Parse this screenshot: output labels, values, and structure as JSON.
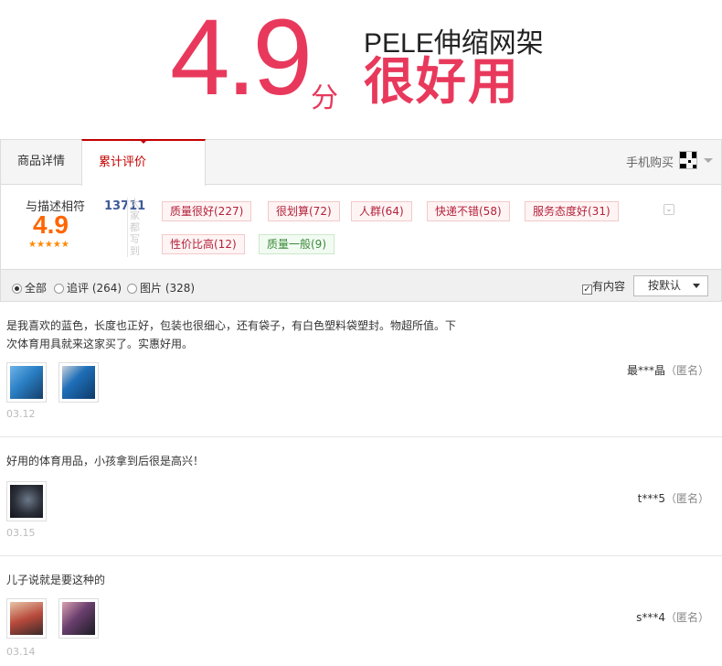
{
  "banner": {
    "score": "4.9",
    "score_unit": "分",
    "product": "PELE伸缩网架",
    "slogan": "很好用"
  },
  "tabs": {
    "details_label": "商品详情",
    "reviews_label": "累计评价",
    "reviews_count": "13711",
    "mobile_buy": "手机购买"
  },
  "summary": {
    "label": "与描述相符",
    "score": "4.9",
    "stars": "★★★★★",
    "vertical_label": "大家都写到",
    "tags": [
      {
        "label": "质量很好(227)",
        "tone": "red"
      },
      {
        "label": "很划算(72)",
        "tone": "red"
      },
      {
        "label": "人群(64)",
        "tone": "red"
      },
      {
        "label": "快递不错(58)",
        "tone": "red"
      },
      {
        "label": "服务态度好(31)",
        "tone": "red"
      },
      {
        "label": "性价比高(12)",
        "tone": "red"
      },
      {
        "label": "质量一般(9)",
        "tone": "green"
      }
    ]
  },
  "filter": {
    "all": "全部",
    "followup": "追评 (264)",
    "pictures": "图片 (328)",
    "has_content": "有内容",
    "sort": "按默认"
  },
  "reviews": [
    {
      "text": "是我喜欢的蓝色，长度也正好，包装也很细心，还有袋子，有白色塑料袋塑封。物超所值。下次体育用具就来这家买了。实惠好用。",
      "user": "最***晶",
      "anon": "（匿名）",
      "date": "03.12",
      "thumb_colors": [
        "#2a7fc4",
        "#1f6fb8"
      ]
    },
    {
      "text": "好用的体育用品，小孩拿到后很是高兴！",
      "user": "t***5",
      "anon": "（匿名）",
      "date": "03.15",
      "thumb_colors": [
        "#2b2f38"
      ]
    },
    {
      "text": "儿子说就是要这种的",
      "user": "s***4",
      "anon": "（匿名）",
      "date": "03.14",
      "thumb_colors": [
        "#b84a3c",
        "#6a3f6e"
      ]
    }
  ],
  "colors": {
    "brand_red": "#e8395c",
    "tab_accent": "#c40000",
    "score_orange": "#ff6600",
    "count_blue": "#3c5a9a"
  }
}
